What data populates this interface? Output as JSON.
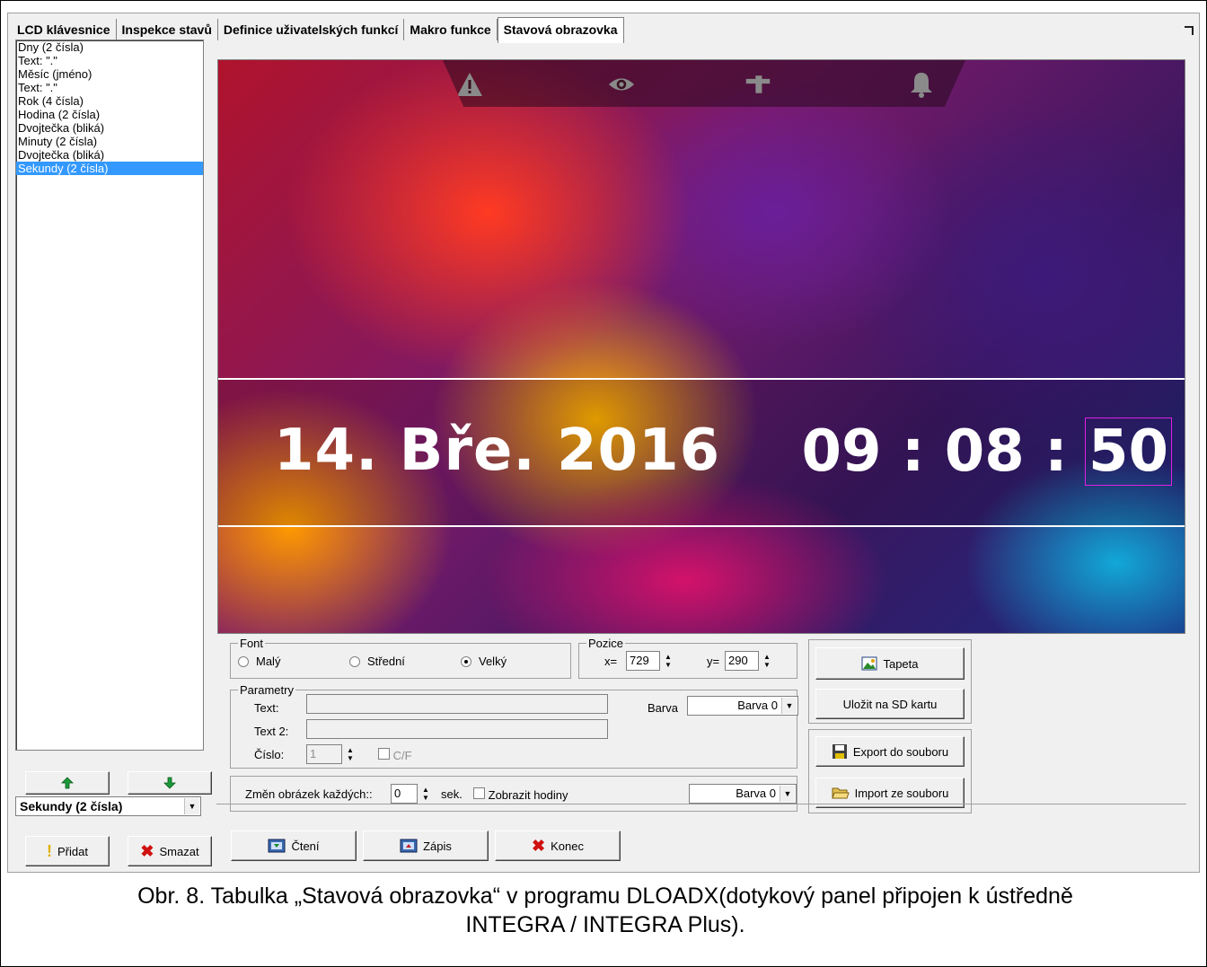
{
  "tabs": [
    {
      "label": "LCD klávesnice"
    },
    {
      "label": "Inspekce stavů"
    },
    {
      "label": "Definice uživatelských funkcí"
    },
    {
      "label": "Makro funkce"
    },
    {
      "label": "Stavová obrazovka"
    }
  ],
  "elements_list": [
    "Dny (2 čísla)",
    "Text: \".\"",
    "Měsíc (jméno)",
    "Text: \".\"",
    "Rok (4 čísla)",
    "Hodina (2 čísla)",
    "Dvojtečka (bliká)",
    "Minuty (2 čísla)",
    "Dvojtečka (bliká)",
    "Sekundy (2 čísla)"
  ],
  "selected_index": 9,
  "left_controls": {
    "type_select_value": "Sekundy (2 čísla)",
    "add_label": "Přidat",
    "delete_label": "Smazat"
  },
  "preview": {
    "date_text": "14. Bře. 2016",
    "time_hh": "09",
    "time_mm": "08",
    "time_ss": "50",
    "sep": " : "
  },
  "font_group": {
    "legend": "Font",
    "small": "Malý",
    "medium": "Střední",
    "large": "Velký",
    "selected": "large"
  },
  "position_group": {
    "legend": "Pozice",
    "x_label": "x=",
    "x_value": "729",
    "y_label": "y=",
    "y_value": "290"
  },
  "params_group": {
    "legend": "Parametry",
    "text_label": "Text:",
    "text_value": "",
    "text2_label": "Text 2:",
    "text2_value": "",
    "number_label": "Číslo:",
    "number_value": "1",
    "cf_label": "C/F",
    "color_label": "Barva",
    "color_value": "Barva 0"
  },
  "change_bar": {
    "label": "Změn obrázek každých::",
    "value": "0",
    "unit": "sek.",
    "show_clock_label": "Zobrazit hodiny",
    "color_value": "Barva 0"
  },
  "right_buttons": {
    "wallpaper": "Tapeta",
    "save_sd": "Uložit na SD kartu",
    "export": "Export do souboru",
    "import": "Import ze souboru"
  },
  "bottom_buttons": {
    "read": "Čtení",
    "write": "Zápis",
    "close": "Konec"
  },
  "caption": {
    "line1_a": "Obr. 8. Tabulka „Stavová obrazovka“ v programu D",
    "line1_b": "LOAD",
    "line1_c": "X(dotykový panel připojen k ústředně",
    "line2": "INTEGRA / INTEGRA Plus)."
  }
}
